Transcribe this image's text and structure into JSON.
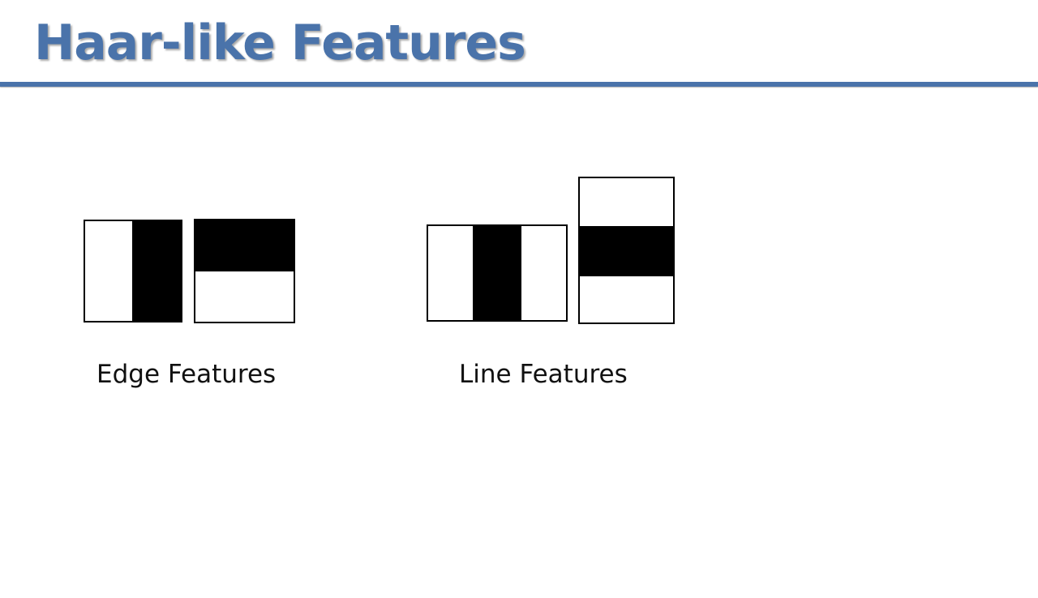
{
  "slide": {
    "title": "Haar-like Features",
    "accent_color": "#4a73aa"
  },
  "groups": [
    {
      "caption": "Edge Features",
      "features": [
        {
          "name": "edge-vertical",
          "pattern": "white-left / black-right"
        },
        {
          "name": "edge-horizontal",
          "pattern": "black-top / white-bottom"
        }
      ]
    },
    {
      "caption": "Line Features",
      "features": [
        {
          "name": "line-vertical",
          "pattern": "white / black / white (columns)"
        },
        {
          "name": "line-horizontal",
          "pattern": "white / black / white (rows)"
        }
      ]
    }
  ]
}
